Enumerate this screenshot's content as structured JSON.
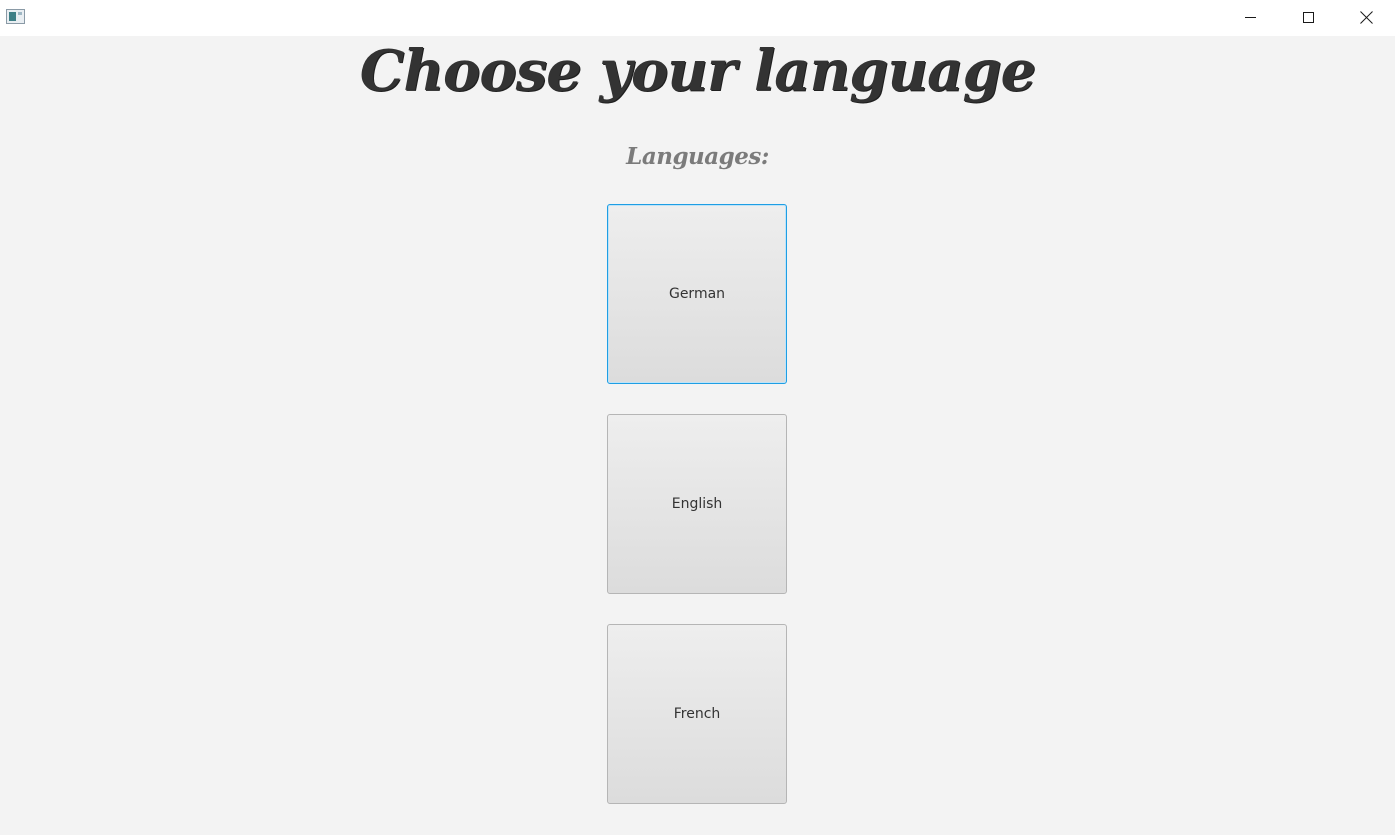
{
  "titlebar": {
    "icon": "java-app-icon",
    "controls": [
      "minimize-icon",
      "maximize-icon",
      "close-icon"
    ]
  },
  "main": {
    "heading": "Choose your language",
    "sublabel": "Languages:",
    "buttons": [
      {
        "label": "German",
        "focused": true
      },
      {
        "label": "English",
        "focused": false
      },
      {
        "label": "French",
        "focused": false
      }
    ]
  },
  "colors": {
    "background": "#f3f3f3",
    "heading": "#333333",
    "sublabel": "#7b7b7b",
    "focus_border": "#1e9ee4"
  }
}
